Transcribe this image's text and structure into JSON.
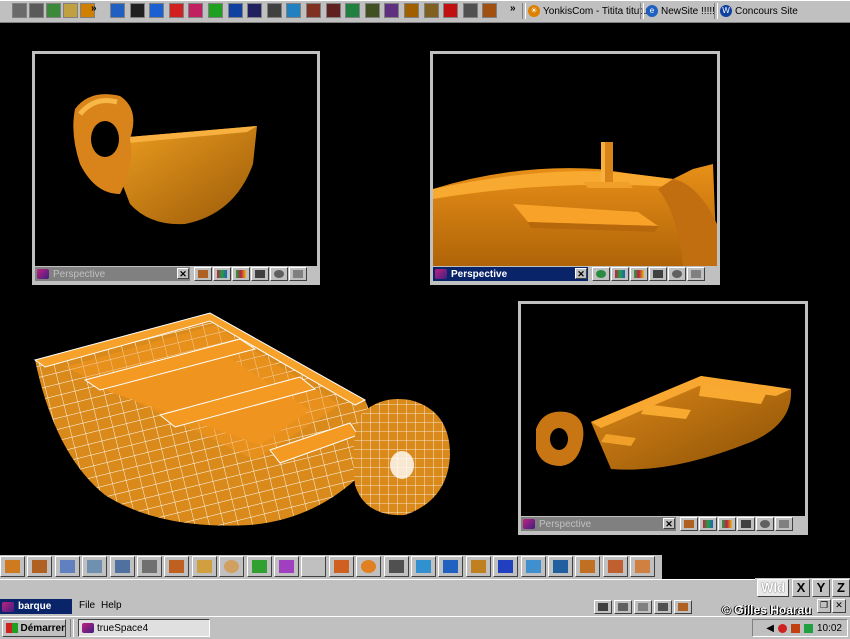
{
  "quicklaunch": {
    "icons": [
      {
        "name": "desktop-icon",
        "color": "#6a6a6a"
      },
      {
        "name": "disk-icon",
        "color": "#5a5a5a"
      },
      {
        "name": "search-icon",
        "color": "#3a8a3a"
      },
      {
        "name": "folder-icon",
        "color": "#c0a040"
      },
      {
        "name": "runner-icon",
        "color": "#d08000"
      },
      {
        "name": "triangle-icon",
        "color": "#2060c0"
      },
      {
        "name": "figure-icon",
        "color": "#202020"
      },
      {
        "name": "ie-icon",
        "color": "#1a60d0"
      },
      {
        "name": "lifebuoy-icon",
        "color": "#d02020"
      },
      {
        "name": "rose-icon",
        "color": "#c02060"
      },
      {
        "name": "lightning-icon",
        "color": "#20a020"
      },
      {
        "name": "flag-icon",
        "color": "#1040a0"
      },
      {
        "name": "user-icon",
        "color": "#202060"
      },
      {
        "name": "ghost-icon",
        "color": "#404040"
      },
      {
        "name": "palette-icon",
        "color": "#2080c0"
      },
      {
        "name": "picture-icon",
        "color": "#803020"
      },
      {
        "name": "gear-icon",
        "color": "#602020"
      },
      {
        "name": "globe-icon",
        "color": "#208040"
      },
      {
        "name": "paint-icon",
        "color": "#405020"
      },
      {
        "name": "hat-icon",
        "color": "#603080"
      },
      {
        "name": "pen-icon",
        "color": "#a06000"
      },
      {
        "name": "brush-icon",
        "color": "#806020"
      },
      {
        "name": "acrobat-icon",
        "color": "#c01010"
      },
      {
        "name": "calculator-icon",
        "color": "#505050"
      },
      {
        "name": "gallery-icon",
        "color": "#a05010"
      }
    ],
    "links": [
      {
        "label": "YonkisCom - Titita titutu",
        "color": "#e08000"
      },
      {
        "label": "NewSite !!!!!",
        "color": "#2060c0"
      },
      {
        "label": "Concours Site",
        "color": "#1040a0"
      }
    ]
  },
  "viewports": [
    {
      "title": "Perspective",
      "active": false
    },
    {
      "title": "Perspective",
      "active": true
    },
    {
      "title": "Perspective",
      "active": false
    }
  ],
  "close_glyph": "✕",
  "accent": "#e08a10",
  "toolbar_icons": [
    "move-icon",
    "cube-icon",
    "sweep-icon",
    "pointer-icon",
    "pen-tool-icon",
    "arrow-down-icon",
    "box-icon",
    "plane-icon",
    "sphere-icon",
    "material-icon",
    "cluster-icon",
    "spline-icon",
    "cut-icon",
    "torus-icon",
    "list-icon",
    "cone-icon",
    "figure-icon",
    "axis-icon",
    "grid-icon",
    "render-icon",
    "3d-text-icon",
    "lathe-icon",
    "rotate-icon",
    "deform-icon"
  ],
  "axis": {
    "wld": "Wld",
    "x": "X",
    "y": "Y",
    "z": "Z"
  },
  "document": {
    "name": "barque"
  },
  "menu": {
    "file": "File",
    "help": "Help"
  },
  "copyright": "© Gilles Hoarau",
  "taskbar": {
    "start": "Démarrer",
    "task": "trueSpace4",
    "clock": "10:02"
  }
}
